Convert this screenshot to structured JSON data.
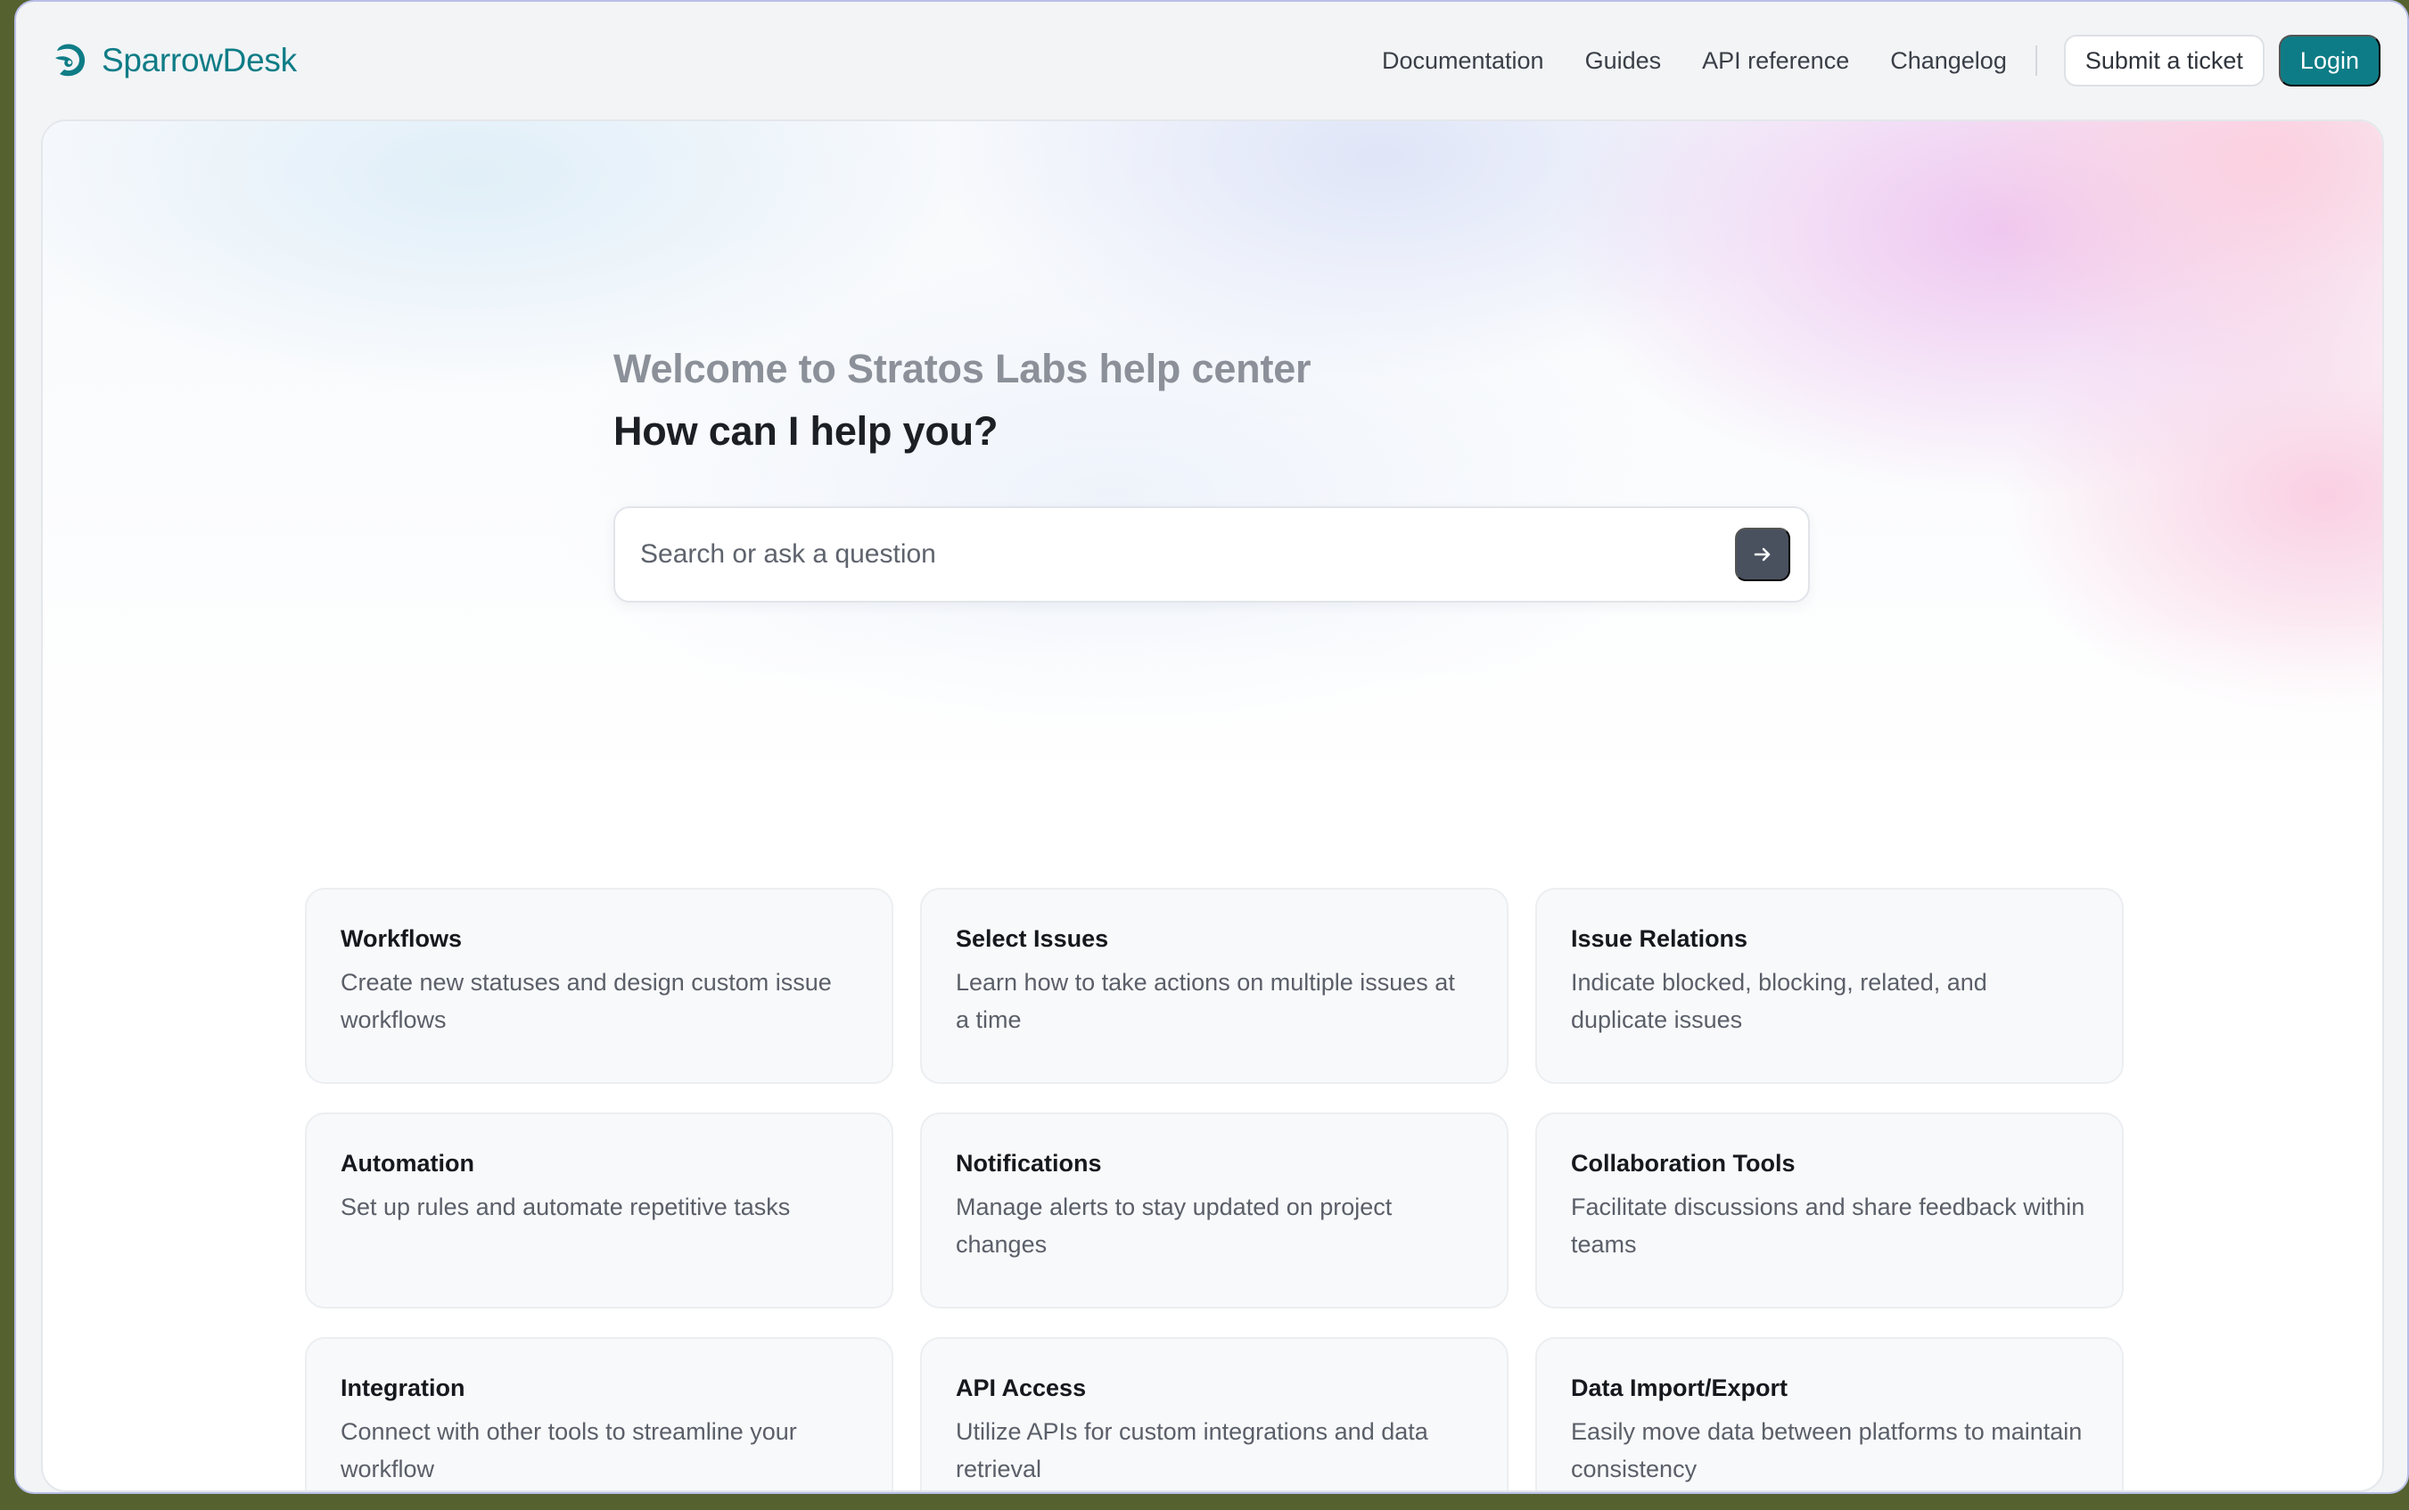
{
  "brand": {
    "name": "SparrowDesk",
    "color": "#0e7c86"
  },
  "nav": {
    "links": [
      {
        "label": "Documentation"
      },
      {
        "label": "Guides"
      },
      {
        "label": "API reference"
      },
      {
        "label": "Changelog"
      }
    ],
    "submit_ticket_label": "Submit a ticket",
    "login_label": "Login"
  },
  "hero": {
    "welcome": "Welcome to Stratos Labs help center",
    "headline": "How can I help you?"
  },
  "search": {
    "placeholder": "Search or ask a question",
    "value": "",
    "submit_icon": "arrow-right-icon"
  },
  "cards": [
    {
      "title": "Workflows",
      "description": "Create new statuses and design custom issue workflows"
    },
    {
      "title": "Select Issues",
      "description": "Learn how to take actions on multiple issues at a time"
    },
    {
      "title": "Issue Relations",
      "description": "Indicate blocked, blocking, related, and duplicate issues"
    },
    {
      "title": "Automation",
      "description": "Set up rules and automate repetitive tasks"
    },
    {
      "title": "Notifications",
      "description": "Manage alerts to stay updated on project changes"
    },
    {
      "title": "Collaboration Tools",
      "description": "Facilitate discussions and share feedback within teams"
    },
    {
      "title": "Integration",
      "description": "Connect with other tools to streamline your workflow"
    },
    {
      "title": "API Access",
      "description": "Utilize APIs for custom integrations and data retrieval"
    },
    {
      "title": "Data Import/Export",
      "description": "Easily move data between platforms to maintain consistency"
    }
  ],
  "colors": {
    "accent": "#0e7c86",
    "search_button": "#49515e"
  }
}
